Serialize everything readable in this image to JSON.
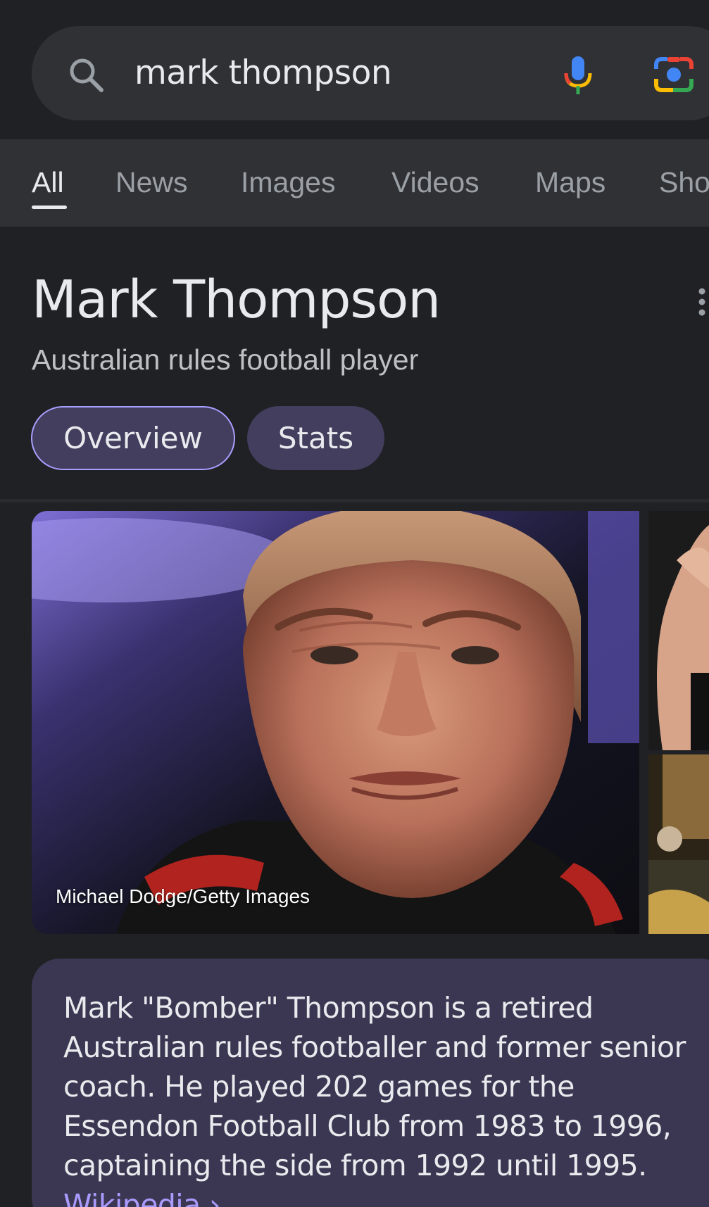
{
  "search": {
    "query": "mark thompson"
  },
  "tabs": [
    {
      "label": "All",
      "active": true
    },
    {
      "label": "News",
      "active": false
    },
    {
      "label": "Images",
      "active": false
    },
    {
      "label": "Videos",
      "active": false
    },
    {
      "label": "Maps",
      "active": false
    },
    {
      "label": "Sho",
      "active": false
    }
  ],
  "knowledge_panel": {
    "title": "Mark Thompson",
    "subtitle": "Australian rules football player",
    "chips": [
      {
        "label": "Overview",
        "selected": true
      },
      {
        "label": "Stats",
        "selected": false
      }
    ],
    "photo_credit": "Michael Dodge/Getty Images",
    "description": "Mark \"Bomber\" Thompson is a retired Australian rules footballer and former senior coach. He played 202 games for the Essendon Football Club from 1983 to 1996, captaining the side from 1992 until 1995.",
    "source_link": "Wikipedia ›"
  },
  "colors": {
    "background": "#202124",
    "search_bar": "#303134",
    "chip_bg": "#433d5e",
    "chip_selected_border": "#a8a0ff",
    "card_bg": "#3b3752",
    "link": "#aa9cff"
  }
}
